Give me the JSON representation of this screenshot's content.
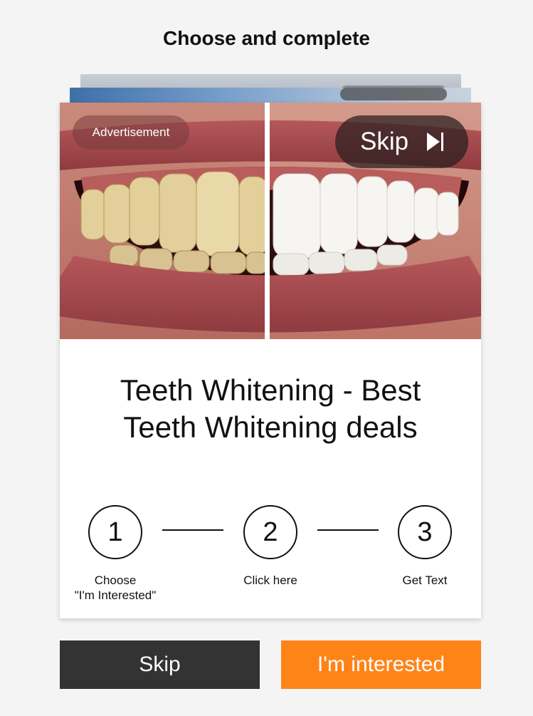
{
  "header": {
    "title": "Choose and complete"
  },
  "ad": {
    "badge": "Advertisement",
    "skip_label": "Skip",
    "title_line1": "Teeth Whitening - Best",
    "title_line2": "Teeth Whitening deals"
  },
  "steps": [
    {
      "number": "1",
      "label_line1": "Choose",
      "label_line2": "\"I'm Interested\""
    },
    {
      "number": "2",
      "label_line1": "Click here",
      "label_line2": ""
    },
    {
      "number": "3",
      "label_line1": "Get Text",
      "label_line2": ""
    }
  ],
  "actions": {
    "skip_label": "Skip",
    "interested_label": "I'm interested"
  },
  "colors": {
    "accent_orange": "#ff8418",
    "dark_button": "#333333",
    "background": "#f4f4f4"
  },
  "icons": {
    "skip": "skip-next-icon"
  }
}
